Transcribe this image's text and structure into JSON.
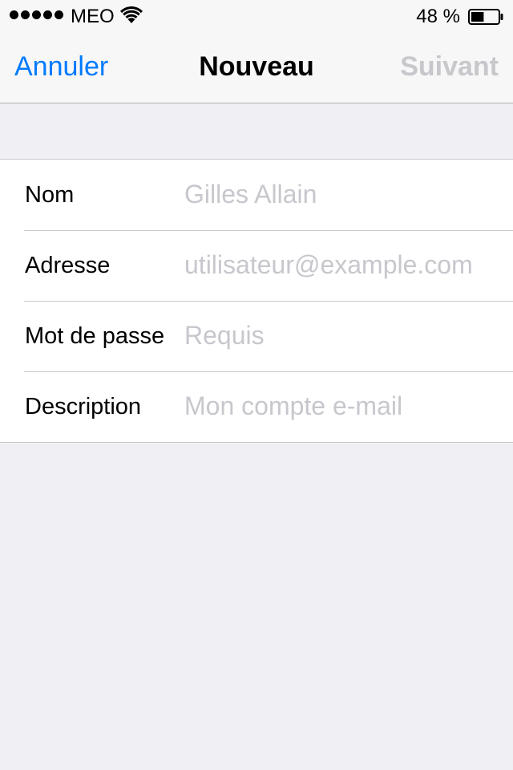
{
  "status_bar": {
    "carrier": "MEO",
    "battery_text": "48 %",
    "battery_level": 0.48,
    "signal_icon": "signal-dots-icon",
    "wifi_icon": "wifi-icon",
    "battery_icon": "battery-icon"
  },
  "nav": {
    "cancel_label": "Annuler",
    "title": "Nouveau",
    "next_label": "Suivant"
  },
  "form": {
    "name": {
      "label": "Nom",
      "value": "",
      "placeholder": "Gilles Allain"
    },
    "address": {
      "label": "Adresse",
      "value": "",
      "placeholder": "utilisateur@example.com"
    },
    "password": {
      "label": "Mot de passe",
      "value": "",
      "placeholder": "Requis"
    },
    "description": {
      "label": "Description",
      "value": "",
      "placeholder": "Mon compte e-mail"
    }
  },
  "colors": {
    "accent": "#007aff",
    "disabled": "#c7c7cc",
    "background": "#efeff4",
    "placeholder": "#c7c7cd"
  }
}
